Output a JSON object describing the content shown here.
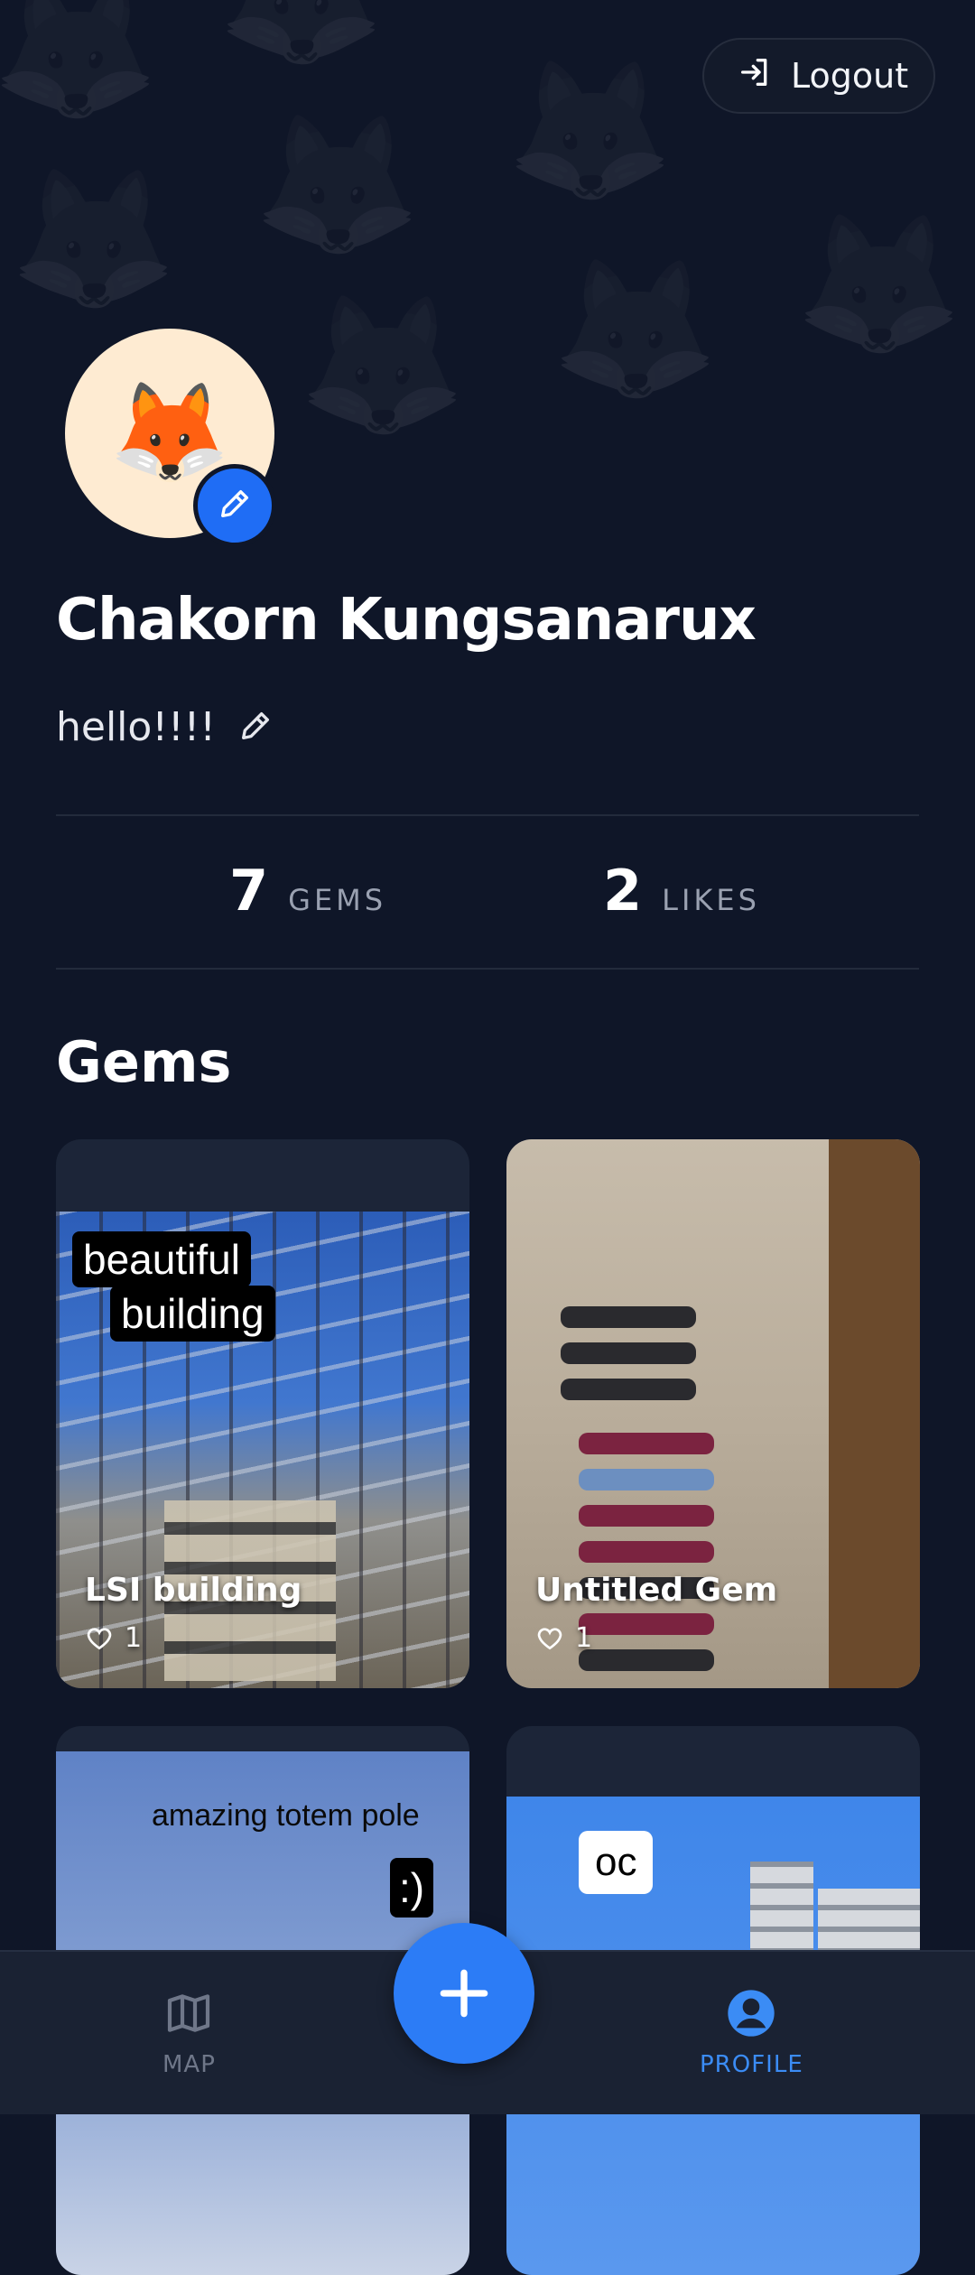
{
  "header": {
    "logout_label": "Logout"
  },
  "profile": {
    "name": "Chakorn Kungsanarux",
    "bio": "hello!!!!",
    "avatar_emoji": "🦊"
  },
  "stats": [
    {
      "value": "7",
      "label": "GEMS"
    },
    {
      "value": "2",
      "label": "LIKES"
    }
  ],
  "gems_section": {
    "title": "Gems",
    "cards": [
      {
        "title": "LSI building",
        "likes": "1",
        "caption_line1": "beautiful",
        "caption_line2": "building"
      },
      {
        "title": "Untitled Gem",
        "likes": "1"
      },
      {
        "caption": "amazing totem pole",
        "caption2": ":)"
      },
      {
        "caption": "oc"
      }
    ]
  },
  "nav": {
    "map_label": "MAP",
    "profile_label": "PROFILE",
    "active_color": "#3b8cf5",
    "inactive_color": "#6f7789"
  },
  "colors": {
    "accent": "#2c7cf6",
    "background": "#0f1628"
  }
}
